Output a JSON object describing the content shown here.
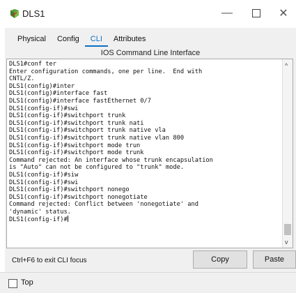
{
  "window": {
    "title": "DLS1",
    "minimize_glyph": "—",
    "close_glyph": "✕"
  },
  "tabs": [
    {
      "label": "Physical",
      "active": false
    },
    {
      "label": "Config",
      "active": false
    },
    {
      "label": "CLI",
      "active": true
    },
    {
      "label": "Attributes",
      "active": false
    }
  ],
  "cli": {
    "heading": "IOS Command Line Interface",
    "lines": [
      "DLS1#conf ter",
      "Enter configuration commands, one per line.  End with",
      "CNTL/Z.",
      "DLS1(config)#inter",
      "DLS1(config)#interface fast",
      "DLS1(config)#interface fastEthernet 0/7",
      "DLS1(config-if)#swi",
      "DLS1(config-if)#switchport trunk",
      "DLS1(config-if)#switchport trunk nati",
      "DLS1(config-if)#switchport trunk native vla",
      "DLS1(config-if)#switchport trunk native vlan 800",
      "DLS1(config-if)#switchport mode trun",
      "DLS1(config-if)#switchport mode trunk",
      "Command rejected: An interface whose trunk encapsulation",
      "is \"Auto\" can not be configured to \"trunk\" mode.",
      "DLS1(config-if)#siw",
      "DLS1(config-if)#swi",
      "DLS1(config-if)#switchport nonego",
      "DLS1(config-if)#switchport nonegotiate",
      "Command rejected: Conflict between 'nonegotiate' and",
      "'dynamic' status.",
      "DLS1(config-if)#"
    ],
    "scroll_up_glyph": "^",
    "scroll_down_glyph": "v"
  },
  "footer": {
    "hint": "Ctrl+F6 to exit CLI focus",
    "copy_label": "Copy",
    "paste_label": "Paste"
  },
  "bottom_bar": {
    "top_checkbox_label": "Top",
    "top_checked": false
  },
  "colors": {
    "accent": "#0a6fc2",
    "panel_bg": "#f0f0f0",
    "button_bg": "#e1e1e1"
  }
}
